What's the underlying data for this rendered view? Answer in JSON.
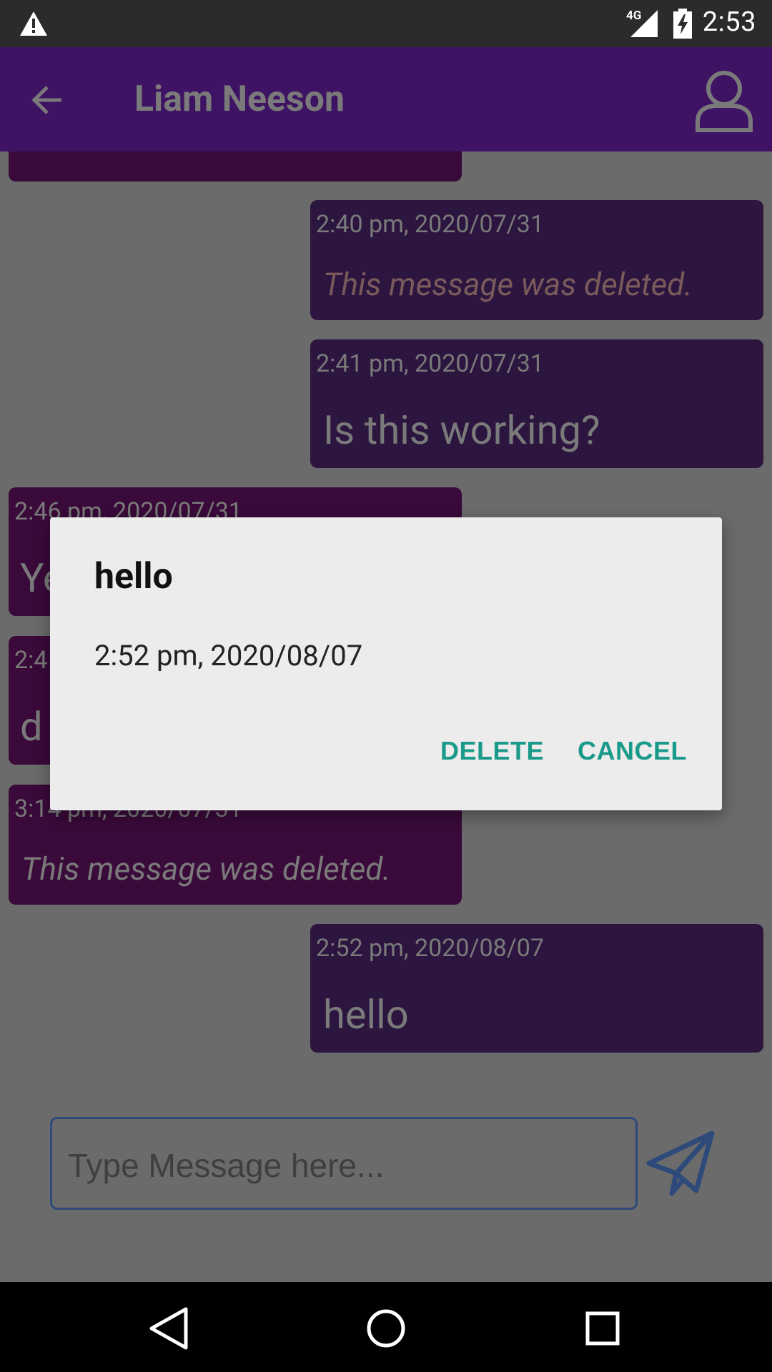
{
  "status_bar": {
    "time": "2:53",
    "network": "4G",
    "icons": [
      "warning-icon",
      "signal-icon",
      "battery-charging-icon"
    ]
  },
  "app_bar": {
    "title": "Liam Neeson",
    "icons": [
      "back-arrow-icon",
      "profile-icon"
    ]
  },
  "messages": [
    {
      "direction": "in",
      "timestamp": "",
      "text": "",
      "deleted": false
    },
    {
      "direction": "out",
      "timestamp": "2:40 pm, 2020/07/31",
      "text": "This message was deleted.",
      "deleted": true
    },
    {
      "direction": "out",
      "timestamp": "2:41 pm, 2020/07/31",
      "text": "Is this working?",
      "deleted": false
    },
    {
      "direction": "in",
      "timestamp": "2:46 pm, 2020/07/31",
      "text": "Ye",
      "deleted": false
    },
    {
      "direction": "in",
      "timestamp": "2:4",
      "text": "d",
      "deleted": false
    },
    {
      "direction": "in",
      "timestamp": "3:14 pm, 2020/07/31",
      "text": "This message was deleted.",
      "deleted": true
    },
    {
      "direction": "out",
      "timestamp": "2:52 pm, 2020/08/07",
      "text": "hello",
      "deleted": false
    }
  ],
  "composer": {
    "placeholder": "Type Message here...",
    "value": "",
    "send_icon": "send-icon"
  },
  "dialog": {
    "title": "hello",
    "body": "2:52 pm, 2020/08/07",
    "delete_label": "DELETE",
    "cancel_label": "CANCEL"
  },
  "nav_bar": {
    "icons": [
      "nav-back-icon",
      "nav-home-icon",
      "nav-recents-icon"
    ]
  },
  "colors": {
    "app_bar": "#3f1364",
    "incoming_bubble": "#3a0a3a",
    "outgoing_bubble": "#2c1640",
    "dialog_button": "#1a9a8a",
    "scrim_background": "#6b6b6b"
  }
}
